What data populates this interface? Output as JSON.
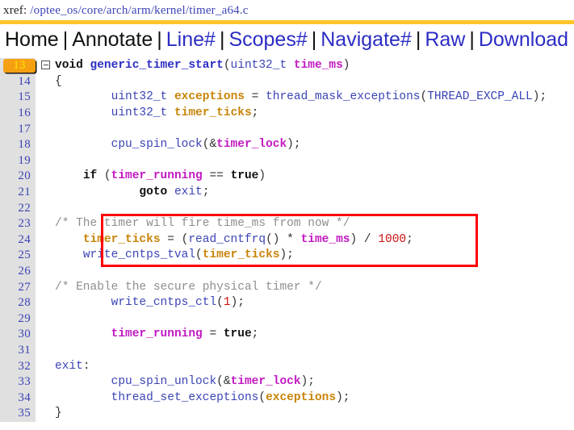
{
  "header": {
    "label": "xref:",
    "path": "/optee_os/core/arch/arm/kernel/timer_a64.c",
    "path_segments": [
      "optee_os",
      "core",
      "arch",
      "arm",
      "kernel",
      "timer_a64.c"
    ],
    "rule_color": "#ffc62a"
  },
  "navbar": {
    "separator": "|",
    "items": [
      {
        "label": "Home",
        "style": "dark"
      },
      {
        "label": "Annotate",
        "style": "dark"
      },
      {
        "label": "Line#",
        "style": "link"
      },
      {
        "label": "Scopes#",
        "style": "link"
      },
      {
        "label": "Navigate#",
        "style": "link"
      },
      {
        "label": "Raw",
        "style": "link"
      },
      {
        "label": "Download",
        "style": "link"
      }
    ],
    "link_color": "#2c2cc4",
    "dark_color": "#111111"
  },
  "editor": {
    "current_line": 13,
    "current_line_bg": "#f5a011",
    "current_line_fg": "#ffe400",
    "gutter_bg": "#e0e0e0",
    "gutter_fg": "#3b44b5",
    "fold_icon": "collapse-box-icon",
    "highlight_box_color": "#ff0000",
    "lines": [
      {
        "n": 13,
        "text": "void generic_timer_start(uint32_t time_ms)"
      },
      {
        "n": 14,
        "text": "{"
      },
      {
        "n": 15,
        "text": "        uint32_t exceptions = thread_mask_exceptions(THREAD_EXCP_ALL);"
      },
      {
        "n": 16,
        "text": "        uint32_t timer_ticks;"
      },
      {
        "n": 17,
        "text": ""
      },
      {
        "n": 18,
        "text": "        cpu_spin_lock(&timer_lock);"
      },
      {
        "n": 19,
        "text": ""
      },
      {
        "n": 20,
        "text": "    if (timer_running == true)"
      },
      {
        "n": 21,
        "text": "            goto exit;"
      },
      {
        "n": 22,
        "text": ""
      },
      {
        "n": 23,
        "text": "    /* The timer will fire time_ms from now */"
      },
      {
        "n": 24,
        "text": "    timer_ticks = (read_cntfrq() * time_ms) / 1000;"
      },
      {
        "n": 25,
        "text": "    write_cntps_tval(timer_ticks);"
      },
      {
        "n": 26,
        "text": ""
      },
      {
        "n": 27,
        "text": "        /* Enable the secure physical timer */"
      },
      {
        "n": 28,
        "text": "        write_cntps_ctl(1);"
      },
      {
        "n": 29,
        "text": ""
      },
      {
        "n": 30,
        "text": "        timer_running = true;"
      },
      {
        "n": 31,
        "text": ""
      },
      {
        "n": 32,
        "text": "exit:"
      },
      {
        "n": 33,
        "text": "        cpu_spin_unlock(&timer_lock);"
      },
      {
        "n": 34,
        "text": "        thread_set_exceptions(exceptions);"
      },
      {
        "n": 35,
        "text": "}"
      }
    ]
  }
}
